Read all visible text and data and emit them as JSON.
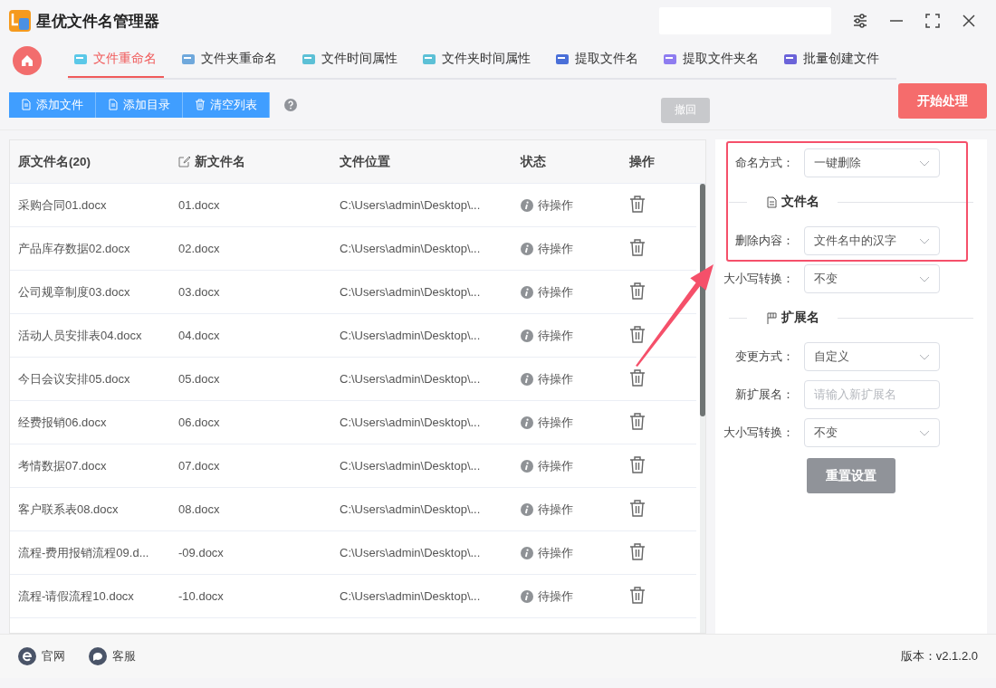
{
  "window": {
    "title": "星优文件名管理器"
  },
  "tabs": [
    {
      "label": "文件重命名",
      "selected": true
    },
    {
      "label": "文件夹重命名",
      "selected": false
    },
    {
      "label": "文件时间属性",
      "selected": false
    },
    {
      "label": "文件夹时间属性",
      "selected": false
    },
    {
      "label": "提取文件名",
      "selected": false
    },
    {
      "label": "提取文件夹名",
      "selected": false
    },
    {
      "label": "批量创建文件",
      "selected": false
    }
  ],
  "toolbar": {
    "buttons": [
      "添加文件",
      "添加目录",
      "清空列表"
    ],
    "undo_button": {
      "label": "撤回",
      "disabled": true
    },
    "start_button": "开始处理"
  },
  "table": {
    "columns": [
      "原文件名(20)",
      "新文件名",
      "文件位置",
      "状态",
      "操作"
    ],
    "rows": [
      {
        "name": "采购合同01.docx",
        "new_name": "01.docx",
        "location": "C:\\Users\\admin\\Desktop\\...",
        "status": "待操作"
      },
      {
        "name": "产品库存数据02.docx",
        "new_name": "02.docx",
        "location": "C:\\Users\\admin\\Desktop\\...",
        "status": "待操作"
      },
      {
        "name": "公司规章制度03.docx",
        "new_name": "03.docx",
        "location": "C:\\Users\\admin\\Desktop\\...",
        "status": "待操作"
      },
      {
        "name": "活动人员安排表04.docx",
        "new_name": "04.docx",
        "location": "C:\\Users\\admin\\Desktop\\...",
        "status": "待操作"
      },
      {
        "name": "今日会议安排05.docx",
        "new_name": "05.docx",
        "location": "C:\\Users\\admin\\Desktop\\...",
        "status": "待操作"
      },
      {
        "name": "经费报销06.docx",
        "new_name": "06.docx",
        "location": "C:\\Users\\admin\\Desktop\\...",
        "status": "待操作"
      },
      {
        "name": "考情数据07.docx",
        "new_name": "07.docx",
        "location": "C:\\Users\\admin\\Desktop\\...",
        "status": "待操作"
      },
      {
        "name": "客户联系表08.docx",
        "new_name": "08.docx",
        "location": "C:\\Users\\admin\\Desktop\\...",
        "status": "待操作"
      },
      {
        "name": "流程-费用报销流程09.d...",
        "new_name": "-09.docx",
        "location": "C:\\Users\\admin\\Desktop\\...",
        "status": "待操作"
      },
      {
        "name": "流程-请假流程10.docx",
        "new_name": "-10.docx",
        "location": "C:\\Users\\admin\\Desktop\\...",
        "status": "待操作"
      }
    ]
  },
  "settings": {
    "items": [
      {
        "kind": "select",
        "label": "命名方式：",
        "value": "一键删除"
      },
      {
        "kind": "section",
        "title": "文件名"
      },
      {
        "kind": "select",
        "label": "删除内容：",
        "value": "文件名中的汉字"
      },
      {
        "kind": "select",
        "label": "大小写转换：",
        "value": "不变"
      },
      {
        "kind": "section",
        "title": "扩展名"
      },
      {
        "kind": "select",
        "label": "变更方式：",
        "value": "自定义"
      },
      {
        "kind": "input",
        "label": "新扩展名：",
        "placeholder": "请输入新扩展名"
      },
      {
        "kind": "select",
        "label": "大小写转换：",
        "value": "不变"
      }
    ],
    "reset_button": "重置设置"
  },
  "footer": {
    "links": [
      "官网",
      "客服"
    ],
    "version": "版本：v2.1.2.0"
  }
}
